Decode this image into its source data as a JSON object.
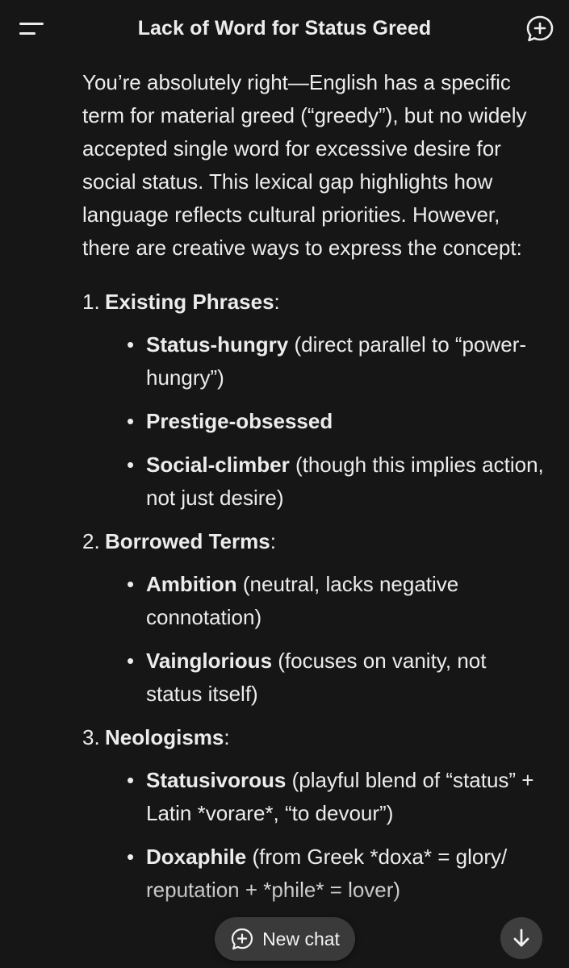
{
  "header": {
    "title": "Lack of Word for Status Greed",
    "menu_icon": "menu-icon",
    "new_chat_icon": "new-chat-icon"
  },
  "message": {
    "intro": "You’re absolutely right—English has a specific term for material greed (“greedy”), but no widely accepted single word for excessive desire for social status. This lexical gap highlights how language reflects cultural priorities. However, there are creative ways to express the concept:",
    "sections": [
      {
        "number": "1.",
        "title": "Existing Phrases",
        "colon": ":",
        "items": [
          {
            "term": "Status-hungry",
            "desc": " (direct parallel to “power-hungry”)"
          },
          {
            "term": "Prestige-obsessed",
            "desc": ""
          },
          {
            "term": "Social-climber",
            "desc": " (though this implies action, not just desire)"
          }
        ]
      },
      {
        "number": "2.",
        "title": "Borrowed Terms",
        "colon": ":",
        "items": [
          {
            "term": "Ambition",
            "desc": " (neutral, lacks negative connotation)"
          },
          {
            "term": "Vainglorious",
            "desc": " (focuses on vanity, not status itself)"
          }
        ]
      },
      {
        "number": "3.",
        "title": "Neologisms",
        "colon": ":",
        "items": [
          {
            "term": "Statusivorous",
            "desc": " (playful blend of “status” + Latin *vorare*, “to devour”)"
          },
          {
            "term": "Doxaphile",
            "desc": " (from Greek *doxa* = glory/ reputation + *phile* = lover)"
          }
        ]
      }
    ]
  },
  "footer": {
    "new_chat_label": "New chat",
    "scroll_icon": "arrow-down-icon"
  }
}
